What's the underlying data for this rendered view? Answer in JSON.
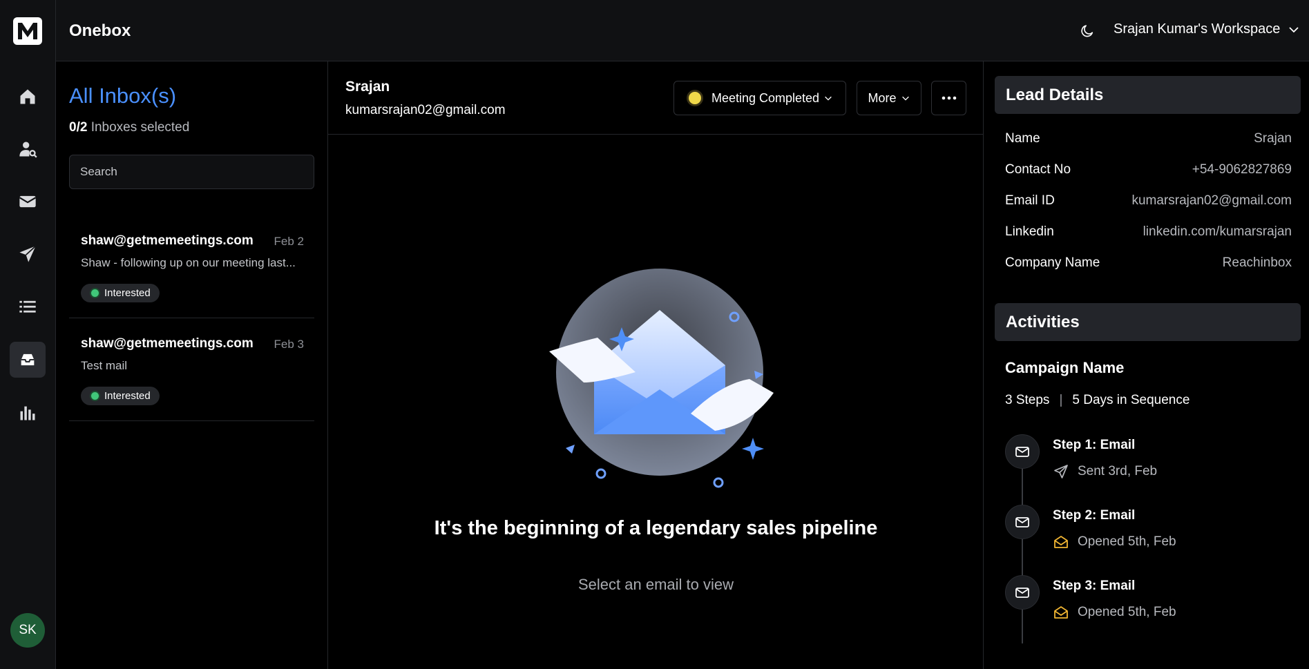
{
  "app": {
    "title": "Onebox",
    "logo_letter": "M"
  },
  "header": {
    "workspace": "Srajan Kumar's Workspace",
    "theme_icon": "moon-icon"
  },
  "user": {
    "initials": "SK"
  },
  "sidebar": {
    "items": [
      {
        "name": "home",
        "icon": "home-icon",
        "active": false
      },
      {
        "name": "user-search",
        "icon": "user-search-icon",
        "active": false
      },
      {
        "name": "mail",
        "icon": "mail-icon",
        "active": false
      },
      {
        "name": "send",
        "icon": "send-icon",
        "active": false
      },
      {
        "name": "list",
        "icon": "list-icon",
        "active": false
      },
      {
        "name": "inbox",
        "icon": "inbox-icon",
        "active": true
      },
      {
        "name": "analytics",
        "icon": "bar-chart-icon",
        "active": false
      }
    ]
  },
  "inbox": {
    "title": "All Inbox(s)",
    "selected_count": "0/2",
    "selected_label": "Inboxes selected",
    "search_placeholder": "Search",
    "threads": [
      {
        "from": "shaw@getmemeetings.com",
        "date": "Feb 2",
        "preview": "Shaw - following up on our meeting last...",
        "badge": "Interested"
      },
      {
        "from": "shaw@getmemeetings.com",
        "date": "Feb 3",
        "preview": "Test mail",
        "badge": "Interested"
      }
    ]
  },
  "conversation": {
    "name": "Srajan",
    "email": "kumarsrajan02@gmail.com",
    "status": "Meeting Completed",
    "more_label": "More",
    "empty_title": "It's the beginning of a legendary sales pipeline",
    "empty_subtitle": "Select an email to view"
  },
  "lead_details": {
    "title": "Lead Details",
    "rows": [
      {
        "label": "Name",
        "value": "Srajan"
      },
      {
        "label": "Contact No",
        "value": "+54-9062827869"
      },
      {
        "label": "Email ID",
        "value": "kumarsrajan02@gmail.com"
      },
      {
        "label": "Linkedin",
        "value": "linkedin.com/kumarsrajan"
      },
      {
        "label": "Company Name",
        "value": "Reachinbox"
      }
    ]
  },
  "activities": {
    "title": "Activities",
    "campaign_name": "Campaign Name",
    "steps_count": "3 Steps",
    "sequence_days": "5 Days in Sequence",
    "steps": [
      {
        "title": "Step 1: Email",
        "status": "Sent 3rd, Feb",
        "status_icon": "send-icon"
      },
      {
        "title": "Step 2: Email",
        "status": "Opened 5th, Feb",
        "status_icon": "mail-open-icon"
      },
      {
        "title": "Step 3: Email",
        "status": "Opened 5th, Feb",
        "status_icon": "mail-open-icon"
      }
    ]
  },
  "colors": {
    "accent": "#4a90ff",
    "status_yellow": "#f0d84a",
    "interested_green": "#41c77a",
    "opened_yellow": "#f2b632"
  }
}
